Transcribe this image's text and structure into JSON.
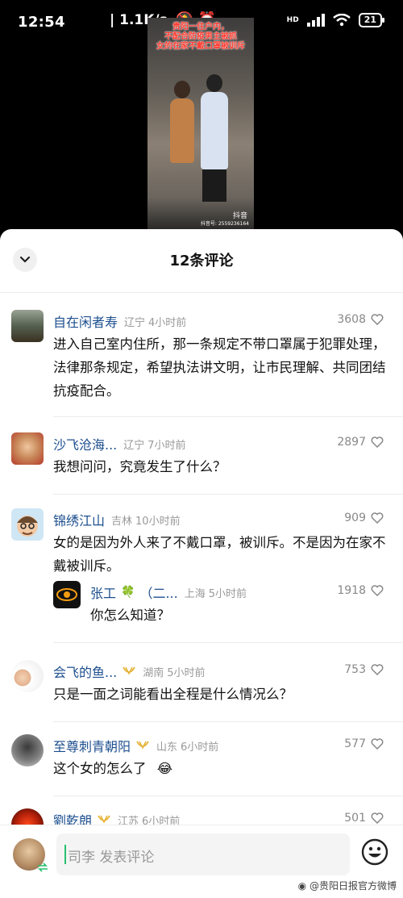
{
  "status_bar": {
    "time": "12:54",
    "speed": "| 1.1K/s",
    "network": "HD",
    "battery": "21"
  },
  "video": {
    "caption": "贵阳一住户内，\n不配合防疫男主被抓\n女的在家不戴口罩被训斥",
    "watermark": "抖音",
    "id": "抖音号: 2559236164"
  },
  "header": {
    "title": "12条评论"
  },
  "comments": [
    {
      "name": "自在闲者寿",
      "region": "辽宁",
      "time": "4小时前",
      "likes": "3608",
      "text": "进入自己室内住所，那一条规定不带口罩属于犯罪处理，法律那条规定，希望执法讲文明，让市民理解、共同团结抗疫配合。"
    },
    {
      "name": "沙飞沧海...",
      "region": "辽宁",
      "time": "7小时前",
      "likes": "2897",
      "text": "我想问问，究竟发生了什么？"
    },
    {
      "name": "锦绣江山",
      "region": "吉林",
      "time": "10小时前",
      "likes": "909",
      "text": "女的是因为外人来了不戴口罩，被训斥。不是因为在家不戴被训斥。"
    },
    {
      "name": "张工",
      "name_suffix": "（二...",
      "region": "上海",
      "time": "5小时前",
      "likes": "1918",
      "text": "你怎么知道？"
    },
    {
      "name": "会飞的鱼...",
      "region": "湖南",
      "time": "5小时前",
      "likes": "753",
      "text": "只是一面之词能看出全程是什么情况么？"
    },
    {
      "name": "至尊刺青朝阳",
      "region": "山东",
      "time": "6小时前",
      "likes": "577",
      "text": "这个女的怎么了"
    },
    {
      "name": "劉乾朗",
      "region": "江苏",
      "time": "6小时前",
      "likes": "501"
    }
  ],
  "input": {
    "placeholder": "司李 发表评论"
  },
  "watermark": "@贵阳日报官方微博",
  "colors": {
    "name": "#1d4f8f",
    "accent": "#25c06d",
    "badge": "#e6b43a"
  }
}
